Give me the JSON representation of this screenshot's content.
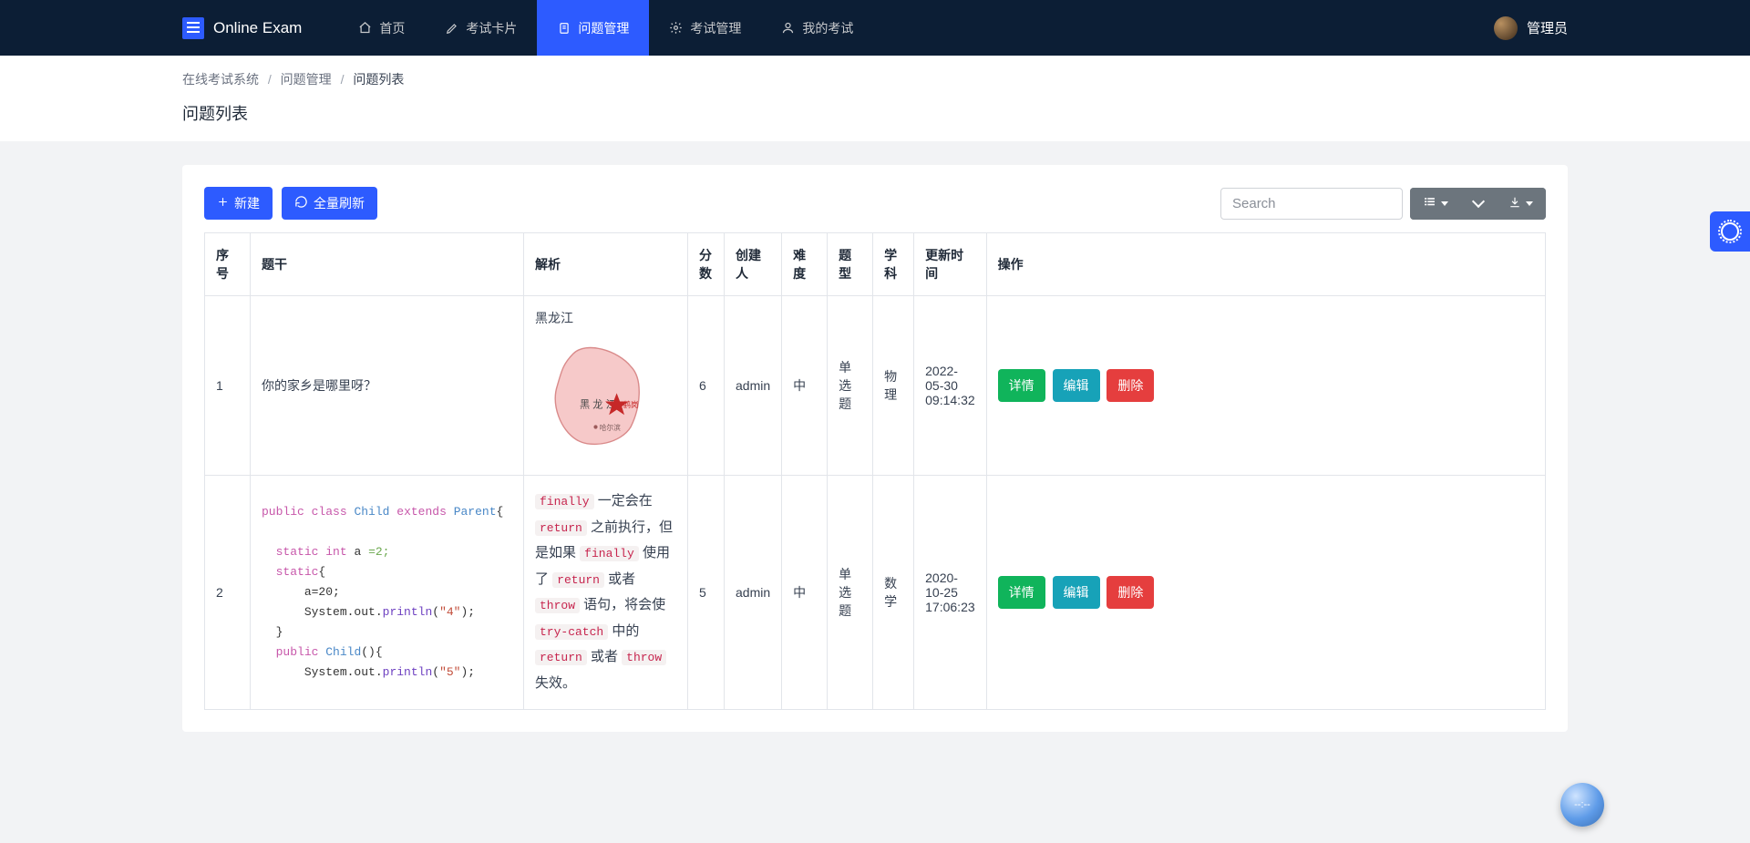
{
  "app": {
    "name": "Online Exam"
  },
  "nav": {
    "items": [
      {
        "label": "首页"
      },
      {
        "label": "考试卡片"
      },
      {
        "label": "问题管理"
      },
      {
        "label": "考试管理"
      },
      {
        "label": "我的考试"
      }
    ],
    "user": "管理员"
  },
  "breadcrumb": {
    "a": "在线考试系统",
    "b": "问题管理",
    "c": "问题列表"
  },
  "page": {
    "title": "问题列表"
  },
  "toolbar": {
    "new_label": "新建",
    "refresh_label": "全量刷新",
    "search_placeholder": "Search"
  },
  "columns": {
    "seq": "序号",
    "stem": "题干",
    "analysis": "解析",
    "score": "分数",
    "creator": "创建人",
    "difficulty": "难度",
    "qtype": "题型",
    "subject": "学科",
    "updated": "更新时间",
    "action": "操作"
  },
  "actions": {
    "detail": "详情",
    "edit": "编辑",
    "delete": "删除"
  },
  "rows": [
    {
      "seq": "1",
      "stem_plain": "你的家乡是哪里呀？",
      "analysis_label": "黑龙江",
      "map_province": "黑 龙 江",
      "map_city1": "鹤岗",
      "map_city2": "哈尔滨",
      "score": "6",
      "creator": "admin",
      "difficulty": "中",
      "qtype": "单选题",
      "subject": "物理",
      "updated": "2022-05-30 09:14:32"
    },
    {
      "seq": "2",
      "code": {
        "kw_public": "public",
        "kw_class": "class",
        "kw_extends": "extends",
        "kw_static": "static",
        "kw_int": "int",
        "typ_child": "Child",
        "typ_parent": "Parent",
        "var_a": "a",
        "val_2": "=2;",
        "stmt_a20": "a=20;",
        "str_4": "\"4\"",
        "str_5": "\"5\"",
        "fn_println": "println",
        "sys_out": "System.out.",
        "brace_open": "{",
        "brace_close": "}",
        "paren_empty": "()",
        "semicolon": ";",
        "paren_open": "(",
        "paren_close": ")"
      },
      "analysis": {
        "c_finally": "finally",
        "t1": " 一定会在 ",
        "c_return": "return",
        "t2": " 之前执行，但是如果 ",
        "t3": " 使用了 ",
        "t4": " 或者 ",
        "c_throw": "throw",
        "t5": " 语句，将会使 ",
        "c_trycatch": "try-catch",
        "t6": " 中的 ",
        "t7": " 或者 ",
        "t8": " 失效。"
      },
      "score": "5",
      "creator": "admin",
      "difficulty": "中",
      "qtype": "单选题",
      "subject": "数学",
      "updated": "2020-10-25 17:06:23"
    }
  ]
}
